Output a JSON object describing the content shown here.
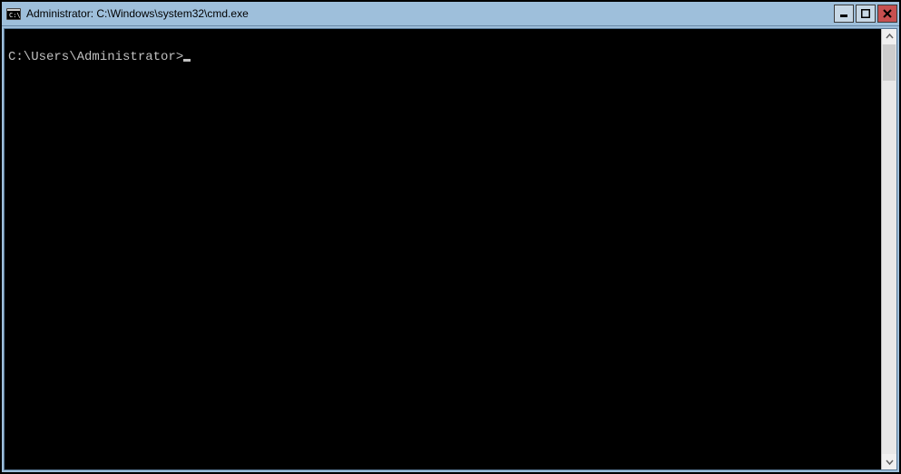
{
  "titlebar": {
    "title": "Administrator: C:\\Windows\\system32\\cmd.exe"
  },
  "terminal": {
    "blank_line": "",
    "prompt": "C:\\Users\\Administrator>"
  }
}
